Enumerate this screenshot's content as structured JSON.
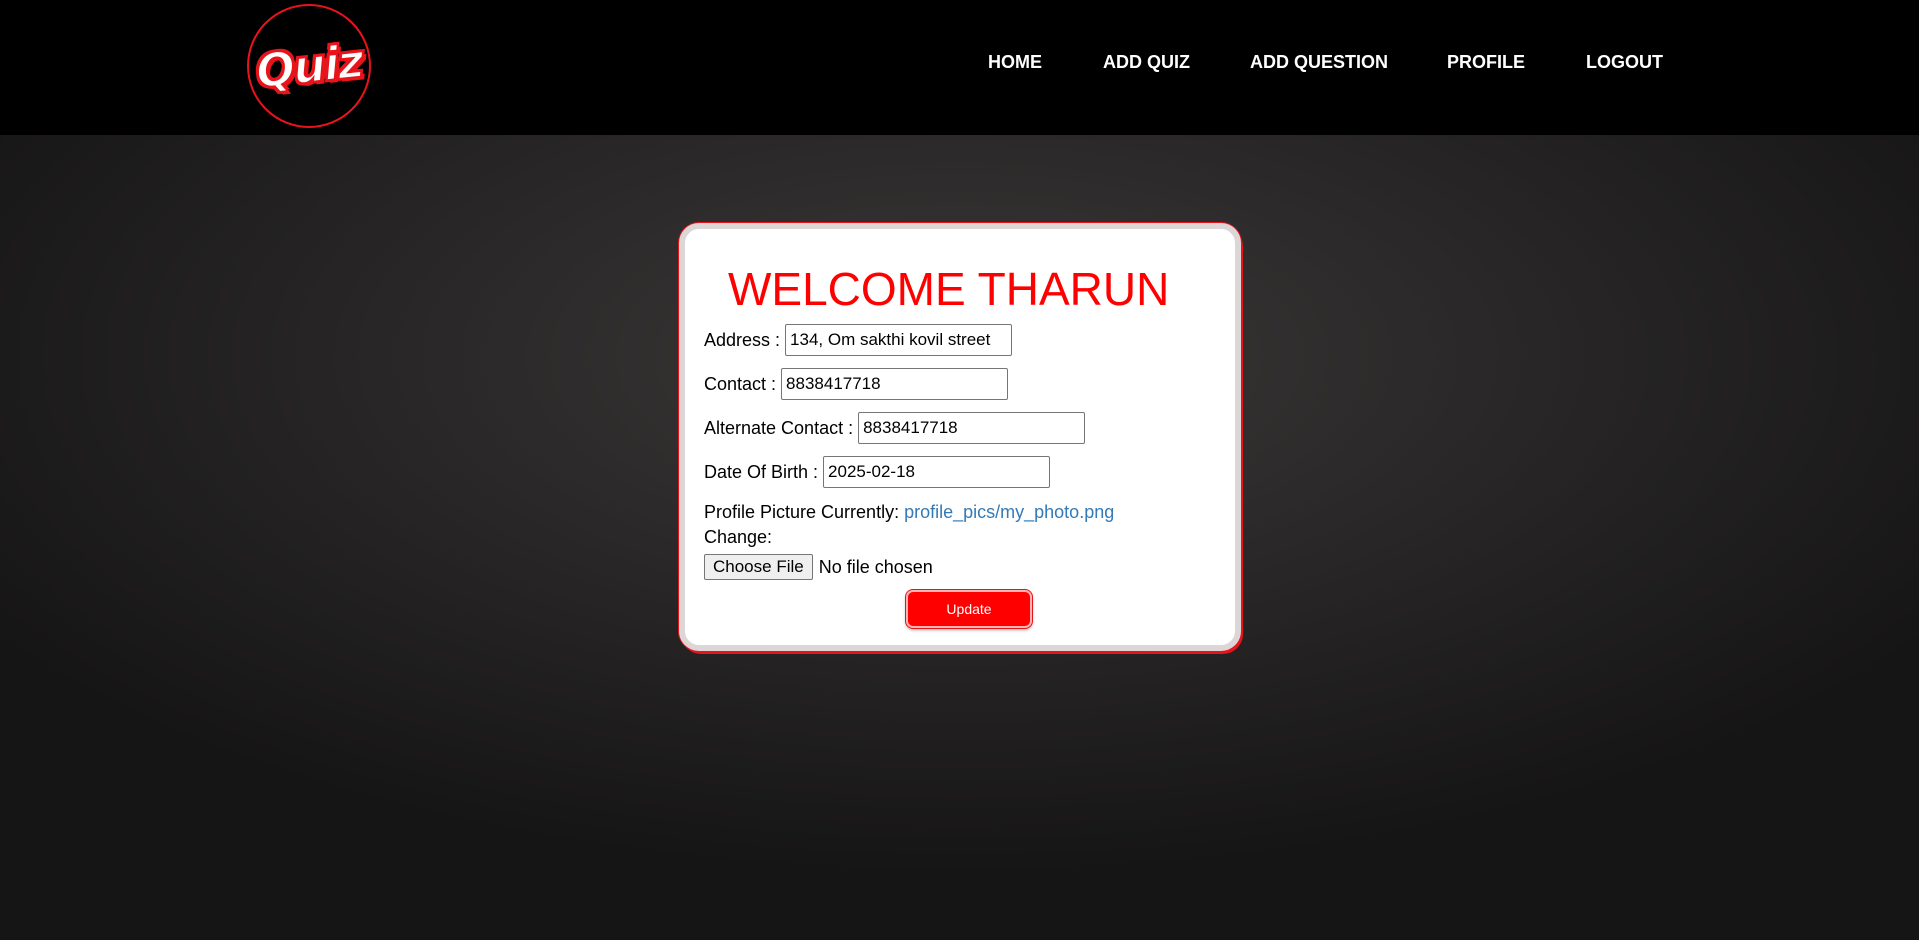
{
  "header": {
    "logo_text": "Quiz",
    "nav": [
      {
        "label": "HOME"
      },
      {
        "label": "ADD QUIZ"
      },
      {
        "label": "ADD QUESTION"
      },
      {
        "label": "PROFILE"
      },
      {
        "label": "LOGOUT"
      }
    ]
  },
  "profile_form": {
    "welcome": "WELCOME THARUN",
    "address": {
      "label": "Address :",
      "value": "134, Om sakthi kovil street"
    },
    "contact": {
      "label": "Contact :",
      "value": "8838417718"
    },
    "alt_contact": {
      "label": "Alternate Contact :",
      "value": "8838417718"
    },
    "dob": {
      "label": "Date Of Birth :",
      "value": "2025-02-18"
    },
    "picture": {
      "label": "Profile Picture Currently:",
      "current": "profile_pics/my_photo.png",
      "change_label": "Change:",
      "choose_button": "Choose File",
      "file_status": "No file chosen"
    },
    "update_button": "Update"
  },
  "colors": {
    "accent": "#ff0000",
    "link": "#337ab7",
    "navbar": "#000000"
  }
}
